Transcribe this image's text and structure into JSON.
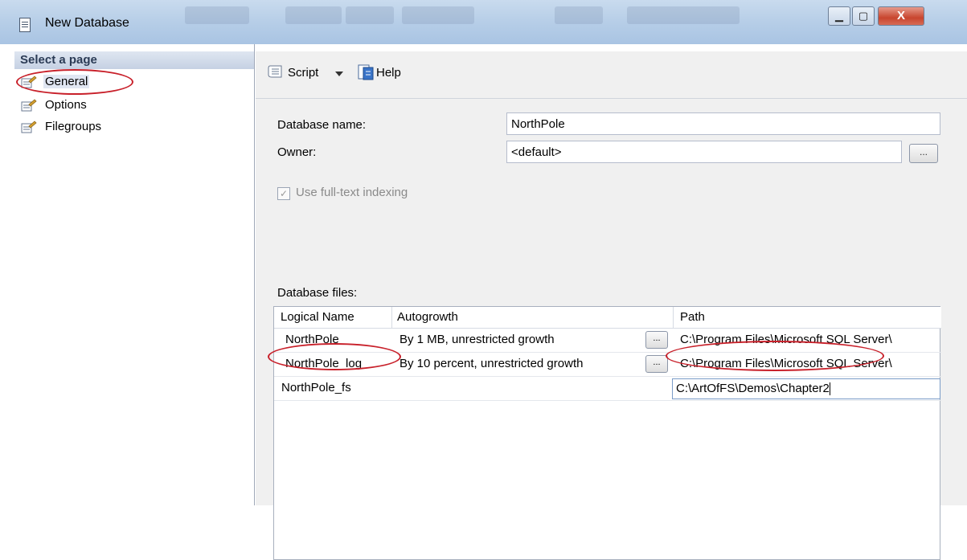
{
  "window": {
    "title": "New Database",
    "controls": {
      "minimize": "▁",
      "maximize": "▢",
      "close": "X"
    }
  },
  "sidebar": {
    "header": "Select a page",
    "items": [
      {
        "label": "General",
        "selected": true,
        "icon": "page-wrench-icon"
      },
      {
        "label": "Options",
        "selected": false,
        "icon": "page-wrench-icon"
      },
      {
        "label": "Filegroups",
        "selected": false,
        "icon": "page-wrench-icon"
      }
    ]
  },
  "toolbar": {
    "script_label": "Script",
    "help_label": "Help",
    "icons": [
      "script-icon",
      "dropdown-arrow-icon",
      "help-icon"
    ]
  },
  "form": {
    "database_name_label": "Database name:",
    "database_name_value": "NorthPole",
    "owner_label": "Owner:",
    "owner_value": "<default>",
    "owner_browse": "...",
    "fulltext_label": "Use full-text indexing",
    "fulltext_checked": true,
    "fulltext_check_glyph": "✓",
    "fulltext_enabled": false,
    "database_files_label": "Database files:"
  },
  "files_table": {
    "columns": [
      "Logical Name",
      "Autogrowth",
      "Path"
    ],
    "rows": [
      {
        "logical_name": "NorthPole",
        "autogrowth": "By 1 MB, unrestricted growth",
        "browse": "...",
        "path": "C:\\Program Files\\Microsoft SQL Server\\"
      },
      {
        "logical_name": "NorthPole_log",
        "autogrowth": "By 10 percent, unrestricted growth",
        "browse": "...",
        "path": "C:\\Program Files\\Microsoft SQL Server\\"
      },
      {
        "logical_name": "NorthPole_fs",
        "autogrowth": "",
        "browse": "",
        "path": "C:\\ArtOfFS\\Demos\\Chapter2"
      }
    ]
  },
  "annotations": {
    "highlight_color": "#c8202a"
  }
}
